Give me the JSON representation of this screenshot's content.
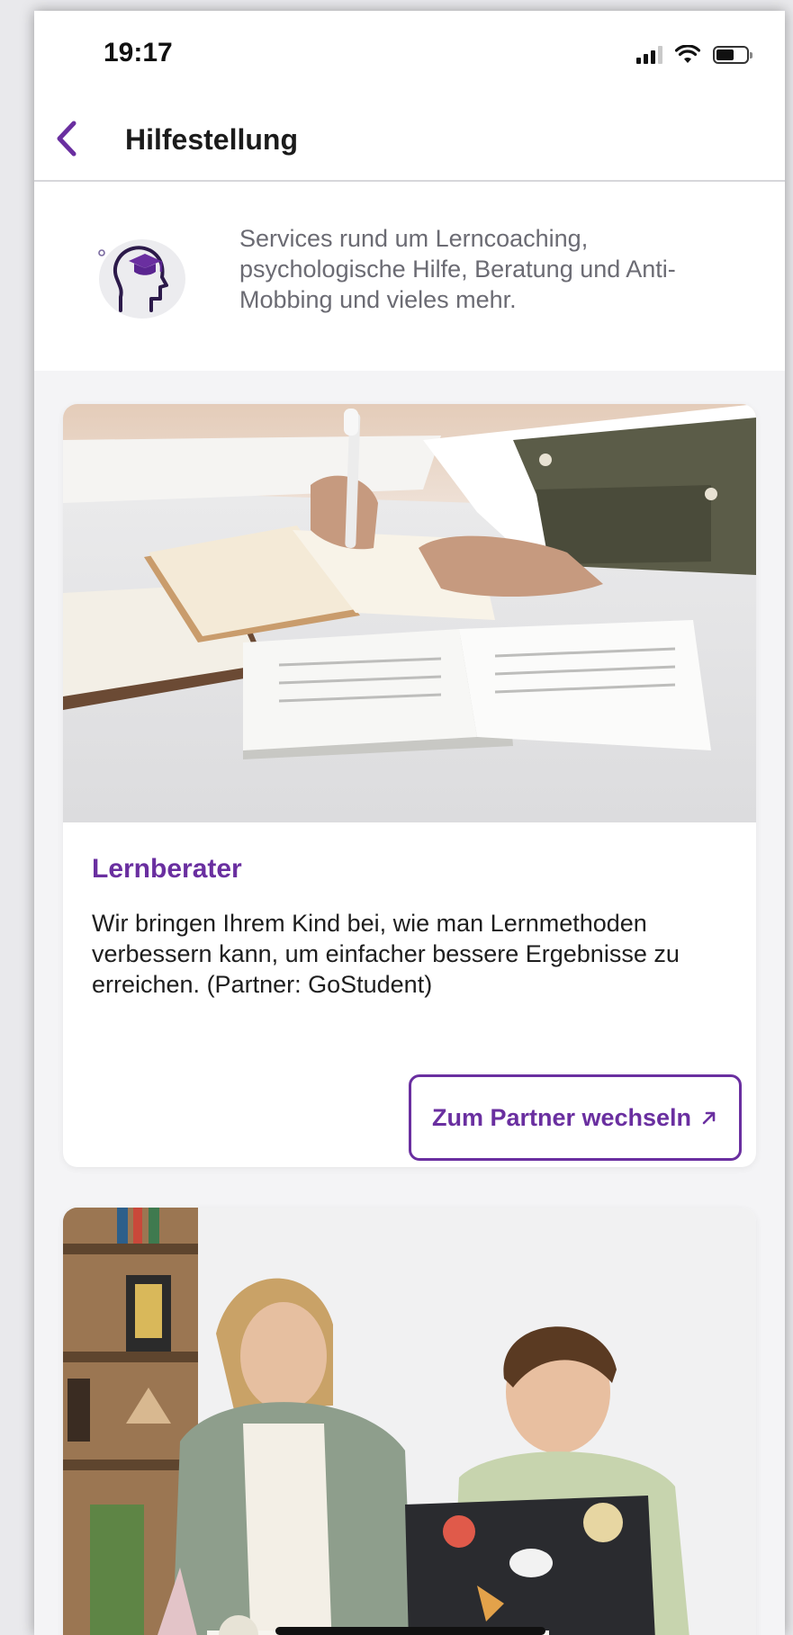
{
  "status_bar": {
    "time": "19:17"
  },
  "nav": {
    "title": "Hilfestellung"
  },
  "intro": {
    "text": "Services rund um Lerncoaching, psychologische Hilfe, Beratung und Anti-Mobbing und vieles mehr."
  },
  "cards": [
    {
      "title": "Lernberater",
      "description": "Wir bringen Ihrem Kind bei, wie man Lernmethoden verbessern kann, um einfacher bessere Ergebnisse zu erreichen. (Partner: GoStudent)",
      "button_label": "Zum Partner wechseln",
      "button_icon": "external-arrow-icon"
    }
  ],
  "colors": {
    "accent": "#6a2fa0",
    "background": "#f4f4f6",
    "text": "#1e1e1e",
    "muted_text": "#6b6b73"
  }
}
